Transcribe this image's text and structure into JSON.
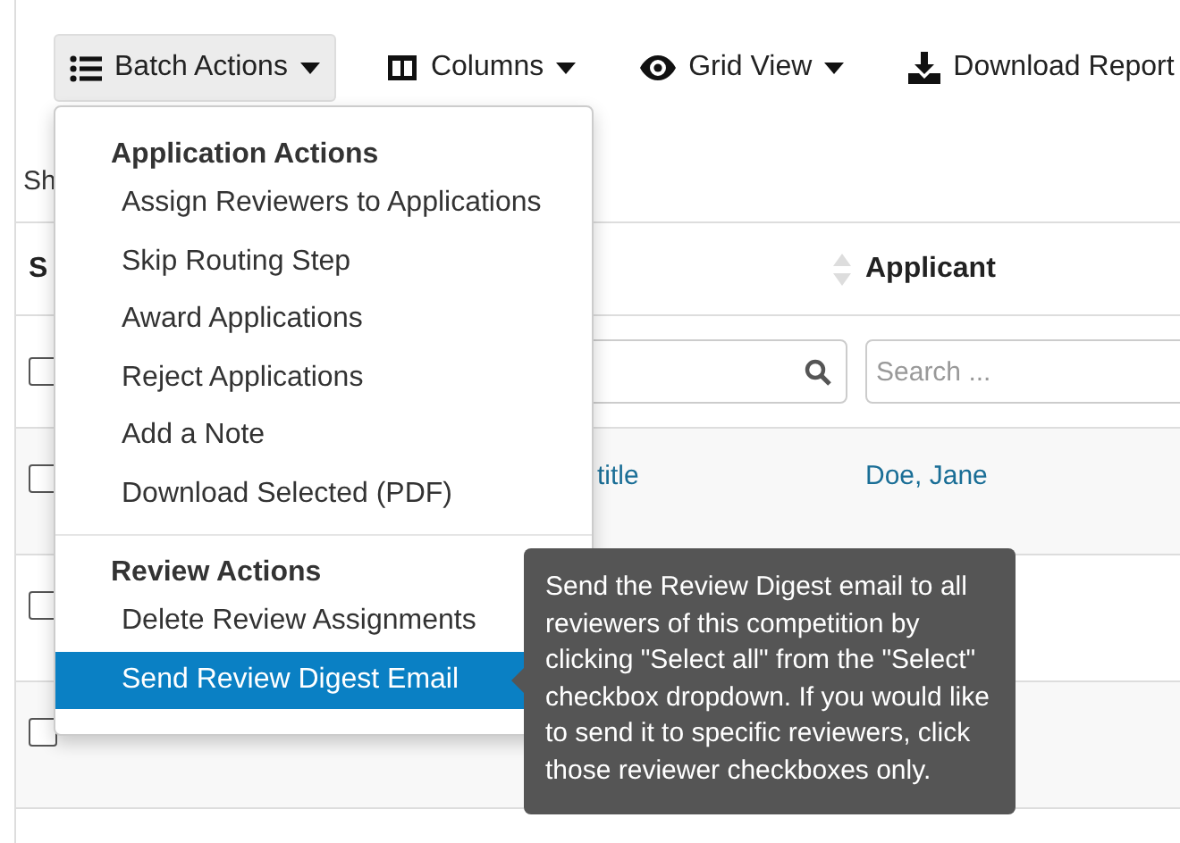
{
  "toolbar": [
    {
      "label": "Batch Actions",
      "kind": "list",
      "selected": true
    },
    {
      "label": "Columns",
      "kind": "columns",
      "selected": false
    },
    {
      "label": "Grid View",
      "kind": "eye",
      "selected": false
    },
    {
      "label": "Download Report",
      "kind": "download",
      "selected": false
    }
  ],
  "summary": "Sh",
  "table": {
    "columns": [
      {
        "label": "S"
      },
      {
        "label": "Applicant"
      }
    ],
    "filters": [
      {
        "kind": "checkbox",
        "checked": false
      },
      {
        "kind": "search-icon"
      },
      {
        "kind": "search",
        "placeholder": "Search ..."
      }
    ],
    "rows": [
      {
        "checked": false,
        "title": "title",
        "applicant": "Doe, Jane"
      },
      {
        "checked": false
      },
      {
        "checked": false
      }
    ]
  },
  "menu": {
    "groups": [
      {
        "heading": "Application Actions",
        "items": [
          {
            "label": "Assign Reviewers to Applications",
            "selected": false
          },
          {
            "label": "Skip Routing Step",
            "selected": false
          },
          {
            "label": "Award Applications",
            "selected": false
          },
          {
            "label": "Reject Applications",
            "selected": false
          },
          {
            "label": "Add a Note",
            "selected": false
          },
          {
            "label": "Download Selected (PDF)",
            "selected": false
          }
        ]
      },
      {
        "heading": "Review Actions",
        "items": [
          {
            "label": "Delete Review Assignments",
            "selected": false
          },
          {
            "label": "Send Review Digest Email",
            "selected": true
          }
        ]
      }
    ]
  },
  "tooltip": "Send the Review Digest email to all reviewers of this competition by clicking \"Select all\" from the \"Select\" checkbox dropdown. If you would like to send it to specific reviewers, click those reviewer checkboxes only."
}
